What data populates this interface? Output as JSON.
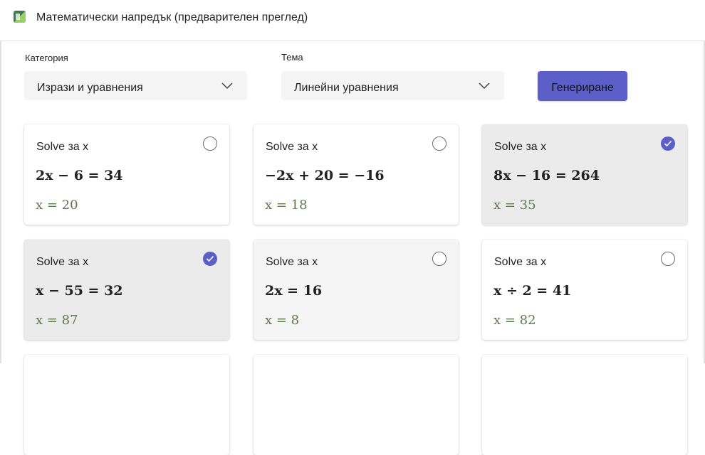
{
  "app": {
    "title": "Математически напредък (предварителен преглед)",
    "accent_color": "#5b5fc7",
    "icon": "math-progress-app-icon"
  },
  "filters": {
    "category_label": "Категория",
    "category_value": "Изрази и уравнения",
    "topic_label": "Тема",
    "topic_value": "Линейни уравнения",
    "generate_label": "Генериране"
  },
  "cards": [
    {
      "label": "Solve за x",
      "equation": "2x − 6 = 34",
      "answer": "x = 20",
      "selected": false
    },
    {
      "label": "Solve за x",
      "equation": "−2x + 20 = −16",
      "answer": "x = 18",
      "selected": false
    },
    {
      "label": "Solve за x",
      "equation": "8x − 16 = 264",
      "answer": "x = 35",
      "selected": true
    },
    {
      "label": "Solve за x",
      "equation": "x − 55 = 32",
      "answer": "x = 87",
      "selected": true
    },
    {
      "label": "Solve за x",
      "equation": "2x = 16",
      "answer": "x = 8",
      "selected": false
    },
    {
      "label": "Solve за x",
      "equation": "x ÷ 2 = 41",
      "answer": "x = 82",
      "selected": false
    }
  ]
}
